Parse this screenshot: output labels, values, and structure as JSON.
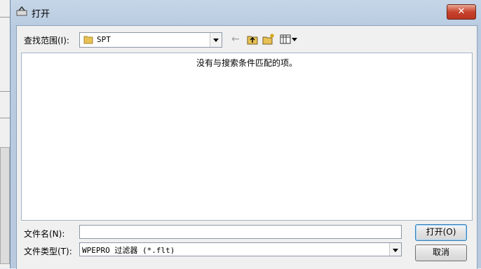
{
  "window": {
    "title": "打开",
    "close_label": "✕"
  },
  "look_in": {
    "label": "查找范围(I):",
    "value": "SPT"
  },
  "file_list": {
    "empty_message": "没有与搜索条件匹配的项。"
  },
  "file_name": {
    "label": "文件名(N):",
    "value": ""
  },
  "file_type": {
    "label": "文件类型(T):",
    "value": "WPEPRO 过滤器 (*.flt)"
  },
  "buttons": {
    "open": "打开(O)",
    "cancel": "取消"
  },
  "colors": {
    "close_button": "#c7432d",
    "folder": "#e8c254",
    "default_button_border": "#3c7fb1"
  },
  "icons": [
    "open-dialog-icon",
    "folder-icon",
    "back-arrow-icon",
    "up-folder-icon",
    "new-folder-icon",
    "view-menu-icon"
  ]
}
